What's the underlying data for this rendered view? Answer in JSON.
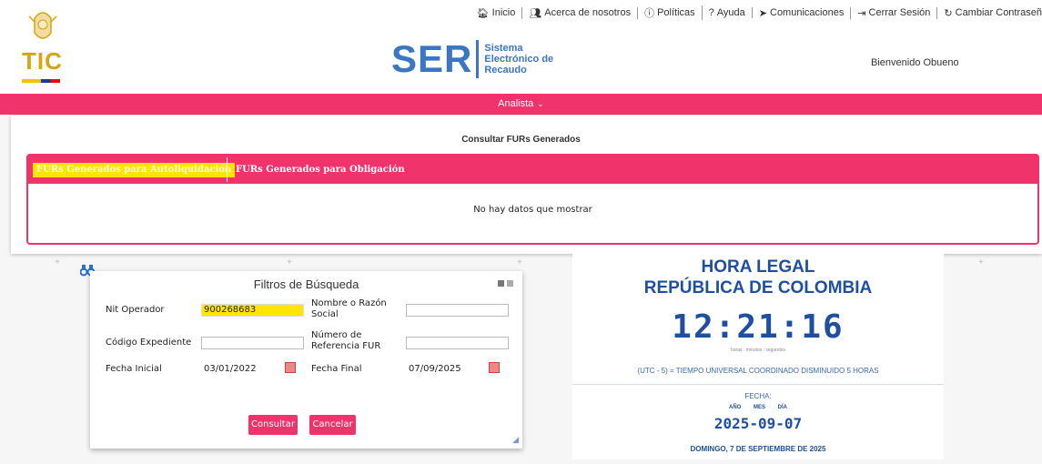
{
  "topnav": {
    "inicio": "Inicio",
    "acerca": "Acerca de nosotros",
    "politicas": "Políticas",
    "ayuda": "Ayuda",
    "comunicaciones": "Comunicaciones",
    "cerrar": "Cerrar Sesión",
    "cambiar": "Cambiar Contraseñ"
  },
  "logo": {
    "tic": "TIC"
  },
  "ser": {
    "big": "SER",
    "line1": "Sistema",
    "line2": "Electrónico de",
    "line3": "Recaudo"
  },
  "welcome": "Bienvenido Obueno",
  "menubar": {
    "label": "Analista"
  },
  "consult": {
    "title": "Consultar FURs Generados",
    "tab1": "FURs Generados para Autoliquidación",
    "tab2": "FURs Generados para Obligación",
    "empty": "No hay datos que mostrar"
  },
  "filtros": {
    "title": "Filtros de Búsqueda",
    "nit_label": "Nit Operador",
    "nit_value": "900268683",
    "razon_label_1": "Nombre o Razón",
    "razon_label_2": "Social",
    "codigo_label": "Código Expediente",
    "ref_label_1": "Número de",
    "ref_label_2": "Referencia FUR",
    "fecha_ini_label": "Fecha Inicial",
    "fecha_ini_value": "03/01/2022",
    "fecha_fin_label": "Fecha Final",
    "fecha_fin_value": "07/09/2025",
    "consultar": "Consultar",
    "cancelar": "Cancelar"
  },
  "hora": {
    "title1": "HORA LEGAL",
    "title2": "REPÚBLICA DE COLOMBIA",
    "time": "12:21:16",
    "units": "horas  :  minutos  :  segundos",
    "utc": "(UTC - 5) = TIEMPO UNIVERSAL COORDINADO DISMINUIDO 5 HORAS",
    "fecha_label": "FECHA:",
    "ymd": "AÑO MES DÍA",
    "date": "2025-09-07",
    "long": "DOMINGO, 7 DE SEPTIEMBRE DE 2025"
  },
  "colors": {
    "accent": "#f0336a",
    "brand_blue": "#3a76c4",
    "highlight": "#ffe600"
  }
}
